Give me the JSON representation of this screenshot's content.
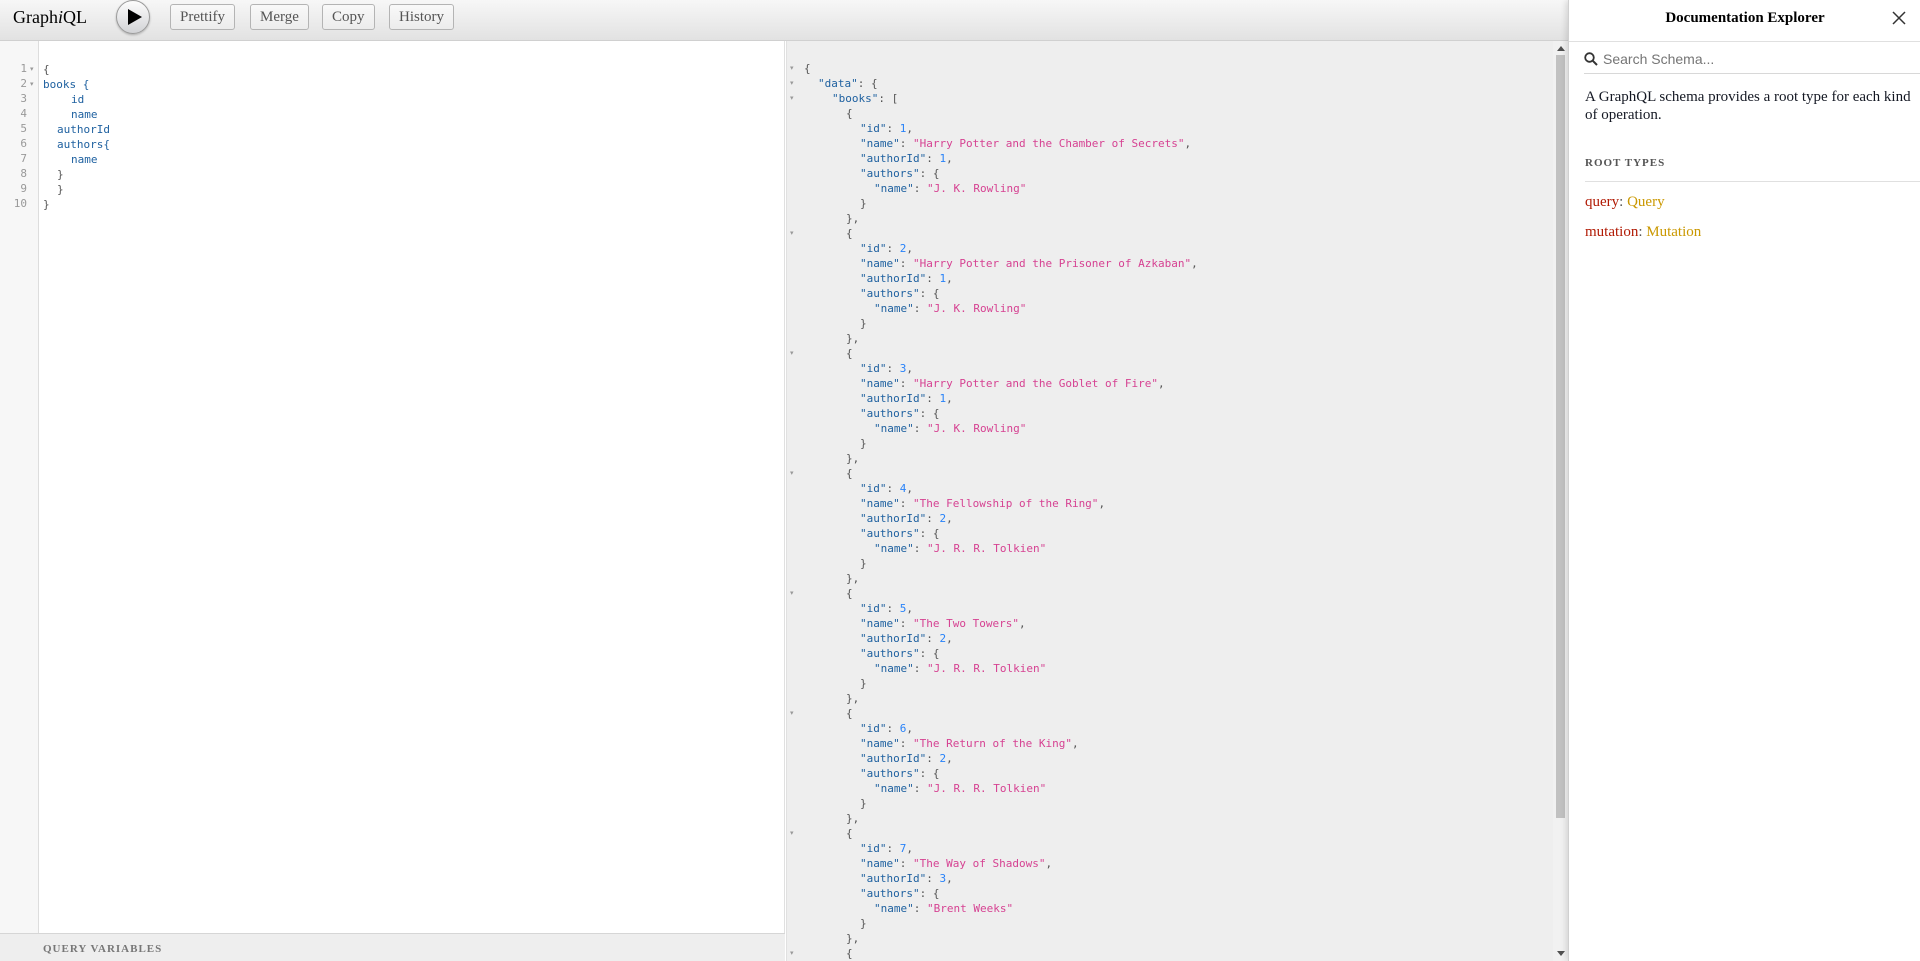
{
  "toolbar": {
    "logo_prefix": "Graph",
    "logo_italic": "i",
    "logo_suffix": "QL",
    "execute_icon": "play-icon",
    "buttons": {
      "prettify": "Prettify",
      "merge": "Merge",
      "copy": "Copy",
      "history": "History"
    }
  },
  "query_editor": {
    "lines": [
      {
        "n": "1",
        "fold": true,
        "text": "{",
        "kind": "punct",
        "indent": 0
      },
      {
        "n": "2",
        "fold": true,
        "text": "books {",
        "kind": "field",
        "indent": 0
      },
      {
        "n": "3",
        "fold": false,
        "text": "id",
        "kind": "field",
        "indent": 4
      },
      {
        "n": "4",
        "fold": false,
        "text": "name",
        "kind": "field",
        "indent": 4
      },
      {
        "n": "5",
        "fold": false,
        "text": "authorId",
        "kind": "field",
        "indent": 2
      },
      {
        "n": "6",
        "fold": false,
        "text": "authors{",
        "kind": "field",
        "indent": 2
      },
      {
        "n": "7",
        "fold": false,
        "text": "name",
        "kind": "field",
        "indent": 4
      },
      {
        "n": "8",
        "fold": false,
        "text": "}",
        "kind": "punct",
        "indent": 2
      },
      {
        "n": "9",
        "fold": false,
        "text": "}",
        "kind": "punct",
        "indent": 2
      },
      {
        "n": "10",
        "fold": false,
        "text": "}",
        "kind": "punct",
        "indent": 0
      }
    ],
    "variables_label": "Query Variables"
  },
  "result": {
    "data_key": "\"data\"",
    "books_key": "\"books\"",
    "keys": {
      "id": "\"id\"",
      "name": "\"name\"",
      "authorId": "\"authorId\"",
      "authors": "\"authors\""
    },
    "books": [
      {
        "id": "1",
        "name": "\"Harry Potter and the Chamber of Secrets\"",
        "authorId": "1",
        "author": "\"J. K. Rowling\""
      },
      {
        "id": "2",
        "name": "\"Harry Potter and the Prisoner of Azkaban\"",
        "authorId": "1",
        "author": "\"J. K. Rowling\""
      },
      {
        "id": "3",
        "name": "\"Harry Potter and the Goblet of Fire\"",
        "authorId": "1",
        "author": "\"J. K. Rowling\""
      },
      {
        "id": "4",
        "name": "\"The Fellowship of the Ring\"",
        "authorId": "2",
        "author": "\"J. R. R. Tolkien\""
      },
      {
        "id": "5",
        "name": "\"The Two Towers\"",
        "authorId": "2",
        "author": "\"J. R. R. Tolkien\""
      },
      {
        "id": "6",
        "name": "\"The Return of the King\"",
        "authorId": "2",
        "author": "\"J. R. R. Tolkien\""
      },
      {
        "id": "7",
        "name": "\"The Way of Shadows\"",
        "authorId": "3",
        "author": "\"Brent Weeks\""
      }
    ]
  },
  "docs": {
    "title": "Documentation Explorer",
    "close_icon": "close-icon",
    "search_icon": "search-icon",
    "search_placeholder": "Search Schema...",
    "description": "A GraphQL schema provides a root type for each kind of operation.",
    "root_types_label": "ROOT TYPES",
    "root_types": [
      {
        "field": "query",
        "type": "Query"
      },
      {
        "field": "mutation",
        "type": "Mutation"
      }
    ]
  },
  "colors": {
    "json_key": "#1f61a0",
    "json_string": "#d64292",
    "json_number": "#2882f9",
    "doc_field": "#b11a04",
    "doc_type": "#ca9800"
  }
}
